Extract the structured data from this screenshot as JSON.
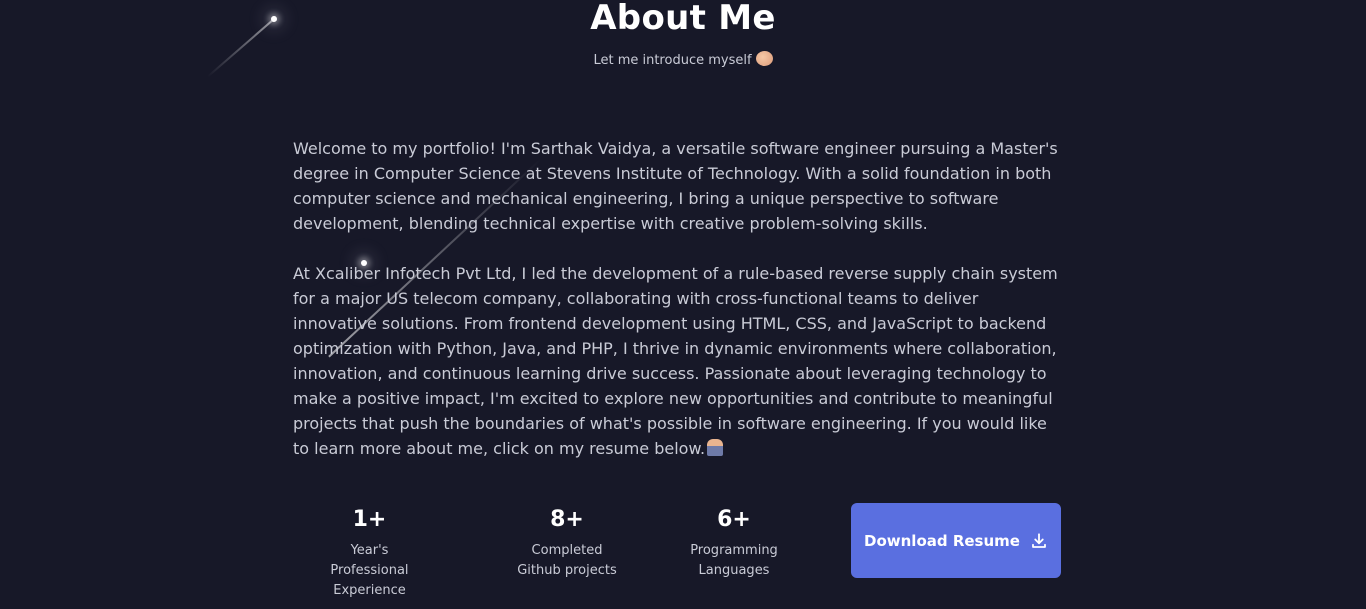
{
  "section": {
    "title": "About Me",
    "subtitle": "Let me introduce myself",
    "subtitle_emoji": "handshake-emoji"
  },
  "bio": {
    "paragraph1": "Welcome to my portfolio! I'm Sarthak Vaidya, a versatile software engineer pursuing a Master's degree in Computer Science at Stevens Institute of Technology. With a solid foundation in both computer science and mechanical engineering, I bring a unique perspective to software development, blending technical expertise with creative problem-solving skills.",
    "paragraph2": "At Xcaliber Infotech Pvt Ltd, I led the development of a rule-based reverse supply chain system for a major US telecom company, collaborating with cross-functional teams to deliver innovative solutions. From frontend development using HTML, CSS, and JavaScript to backend optimization with Python, Java, and PHP, I thrive in dynamic environments where collaboration, innovation, and continuous learning drive success. Passionate about leveraging technology to make a positive impact, I'm excited to explore new opportunities and contribute to meaningful projects that push the boundaries of what's possible in software engineering. If you would like to learn more about me, click on my resume below.",
    "paragraph2_emoji": "technologist-emoji"
  },
  "stats": [
    {
      "value": "1+",
      "line1": "Year's",
      "line2": "Professional Experience"
    },
    {
      "value": "8+",
      "line1": "Completed",
      "line2": "Github projects"
    },
    {
      "value": "6+",
      "line1": "Programming",
      "line2": "Languages"
    }
  ],
  "cta": {
    "label": "Download Resume",
    "icon": "download-icon"
  },
  "colors": {
    "background": "#171828",
    "heading": "#ffffff",
    "body_text": "#c9cbd6",
    "button": "#5a6fe0"
  }
}
